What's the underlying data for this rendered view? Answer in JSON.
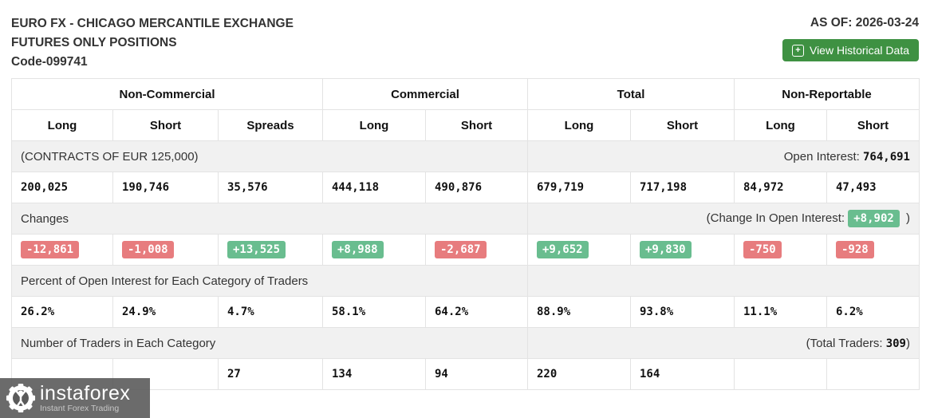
{
  "header": {
    "title_line1": "EURO FX - CHICAGO MERCANTILE EXCHANGE",
    "title_line2": "FUTURES ONLY POSITIONS",
    "code": "Code-099741",
    "as_of": "AS OF: 2026-03-24",
    "button_label": "View Historical Data"
  },
  "table": {
    "groups": [
      "Non-Commercial",
      "Commercial",
      "Total",
      "Non-Reportable"
    ],
    "columns": [
      "Long",
      "Short",
      "Spreads",
      "Long",
      "Short",
      "Long",
      "Short",
      "Long",
      "Short"
    ],
    "contracts_label": "(CONTRACTS OF EUR 125,000)",
    "open_interest_label": "Open Interest:",
    "open_interest_value": "764,691",
    "positions": [
      "200,025",
      "190,746",
      "35,576",
      "444,118",
      "490,876",
      "679,719",
      "717,198",
      "84,972",
      "47,493"
    ],
    "changes_label": "Changes",
    "change_oi_prefix": "(Change In Open Interest:",
    "change_oi_value": "+8,902",
    "change_oi_suffix": ")",
    "changes": [
      "-12,861",
      "-1,008",
      "+13,525",
      "+8,988",
      "-2,687",
      "+9,652",
      "+9,830",
      "-750",
      "-928"
    ],
    "percent_label": "Percent of Open Interest for Each Category of Traders",
    "percents": [
      "26.2%",
      "24.9%",
      "4.7%",
      "58.1%",
      "64.2%",
      "88.9%",
      "93.8%",
      "11.1%",
      "6.2%"
    ],
    "traders_label": "Number of Traders in Each Category",
    "total_traders_prefix": "(Total Traders:",
    "total_traders_value": "309",
    "total_traders_suffix": ")",
    "traders": [
      "",
      "",
      "27",
      "134",
      "94",
      "220",
      "164",
      "",
      ""
    ]
  },
  "watermark": {
    "brand": "instaforex",
    "tagline": "Instant Forex Trading"
  },
  "colors": {
    "positive_badge": "#69bd8f",
    "negative_badge": "#e77c7e",
    "button_green": "#3e9142",
    "label_row_bg": "#f1f1f1",
    "border": "#e3e3e3"
  }
}
